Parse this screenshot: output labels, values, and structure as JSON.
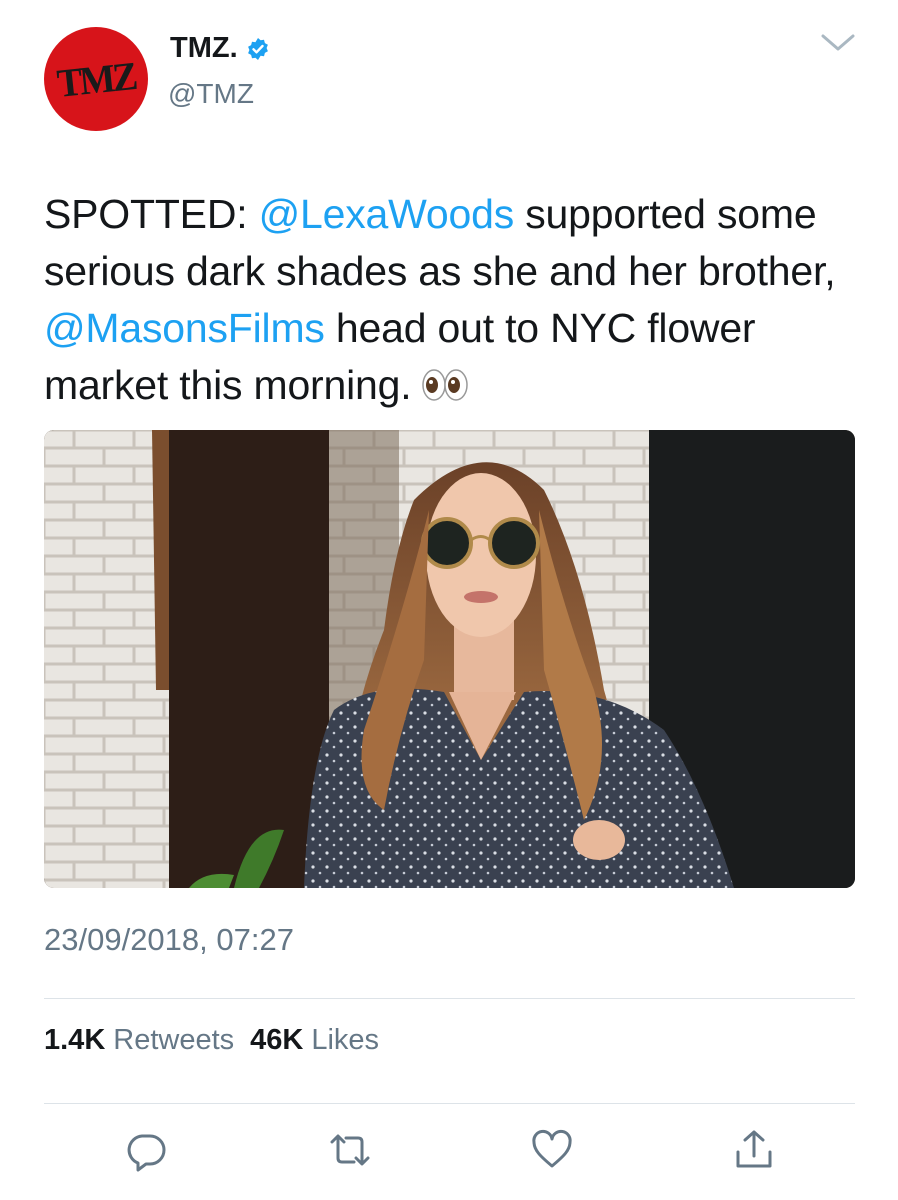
{
  "account": {
    "avatar_text": "TMZ",
    "display_name": "TMZ.",
    "handle": "@TMZ",
    "verified": true,
    "brand_color": "#d7141a"
  },
  "tweet": {
    "segments": [
      {
        "text": "SPOTTED: ",
        "type": "text"
      },
      {
        "text": "@LexaWoods",
        "type": "mention"
      },
      {
        "text": " supported some serious dark shades as she and her brother, ",
        "type": "text"
      },
      {
        "text": "@MasonsFilms",
        "type": "mention"
      },
      {
        "text": " head out to NYC flower market this morning.",
        "type": "text"
      }
    ],
    "emoji": "eyes-emoji",
    "timestamp": "23/09/2018, 07:27"
  },
  "stats": {
    "retweets_count": "1.4K",
    "retweets_label": "Retweets",
    "likes_count": "46K",
    "likes_label": "Likes"
  },
  "actions": [
    "reply-icon",
    "retweet-icon",
    "like-icon",
    "share-icon"
  ],
  "colors": {
    "mention": "#1da1f2",
    "secondary_text": "#657786",
    "icon": "#657786"
  }
}
